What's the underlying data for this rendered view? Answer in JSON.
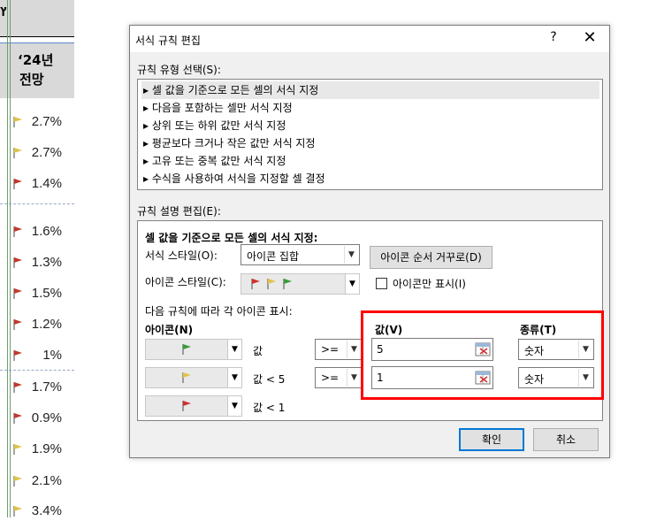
{
  "sheet": {
    "header_fragment": "ץ",
    "column_header_line1": "‘24년",
    "column_header_line2": "전망",
    "rows": [
      {
        "value": "2.7%",
        "flag": "#e0c24a"
      },
      {
        "value": "2.7%",
        "flag": "#e0c24a"
      },
      {
        "value": "1.4%",
        "flag": "#c0392b"
      },
      {
        "value": "1.6%",
        "flag": "#c0392b"
      },
      {
        "value": "1.3%",
        "flag": "#c0392b"
      },
      {
        "value": "1.5%",
        "flag": "#c0392b"
      },
      {
        "value": "1.2%",
        "flag": "#c0392b"
      },
      {
        "value": "1%",
        "flag": "#c0392b"
      },
      {
        "value": "1.7%",
        "flag": "#c0392b"
      },
      {
        "value": "0.9%",
        "flag": "#c0392b"
      },
      {
        "value": "1.9%",
        "flag": "#e0c24a"
      },
      {
        "value": "2.1%",
        "flag": "#e0c24a"
      },
      {
        "value": "3.4%",
        "flag": "#e0c24a"
      }
    ]
  },
  "dialog": {
    "title": "서식 규칙 편집",
    "help_label": "?",
    "close_label": "✕",
    "rule_type_label": "규칙 유형 선택(S):",
    "rule_types": [
      "▸ 셀 값을 기준으로 모든 셀의 서식 지정",
      "▸ 다음을 포함하는 셀만 서식 지정",
      "▸ 상위 또는 하위 값만 서식 지정",
      "▸ 평균보다 크거나 작은 값만 서식 지정",
      "▸ 고유 또는 중복 값만 서식 지정",
      "▸ 수식을 사용하여 서식을 지정할 셀 결정"
    ],
    "rule_desc_label": "규칙 설명 편집(E):",
    "desc_heading": "셀 값을 기준으로 모든 셀의 서식 지정:",
    "format_style_label": "서식 스타일(O):",
    "format_style_value": "아이콘 집합",
    "reverse_button": "아이콘 순서 거꾸로(D)",
    "icon_style_label": "아이콘 스타일(C):",
    "icon_only_label": "아이콘만 표시(I)",
    "rules_caption": "다음 규칙에 따라 각 아이콘 표시:",
    "col_icon": "아이콘(N)",
    "col_value": "값(V)",
    "col_type": "종류(T)",
    "rules": [
      {
        "flag": "#3a9a3a",
        "cond": "값",
        "op": ">=",
        "value": "5",
        "type": "숫자"
      },
      {
        "flag": "#e0c24a",
        "cond": "값 < 5",
        "op": ">=",
        "value": "1",
        "type": "숫자"
      },
      {
        "flag": "#d03030",
        "cond": "값 < 1"
      }
    ],
    "ok_label": "확인",
    "cancel_label": "취소"
  }
}
